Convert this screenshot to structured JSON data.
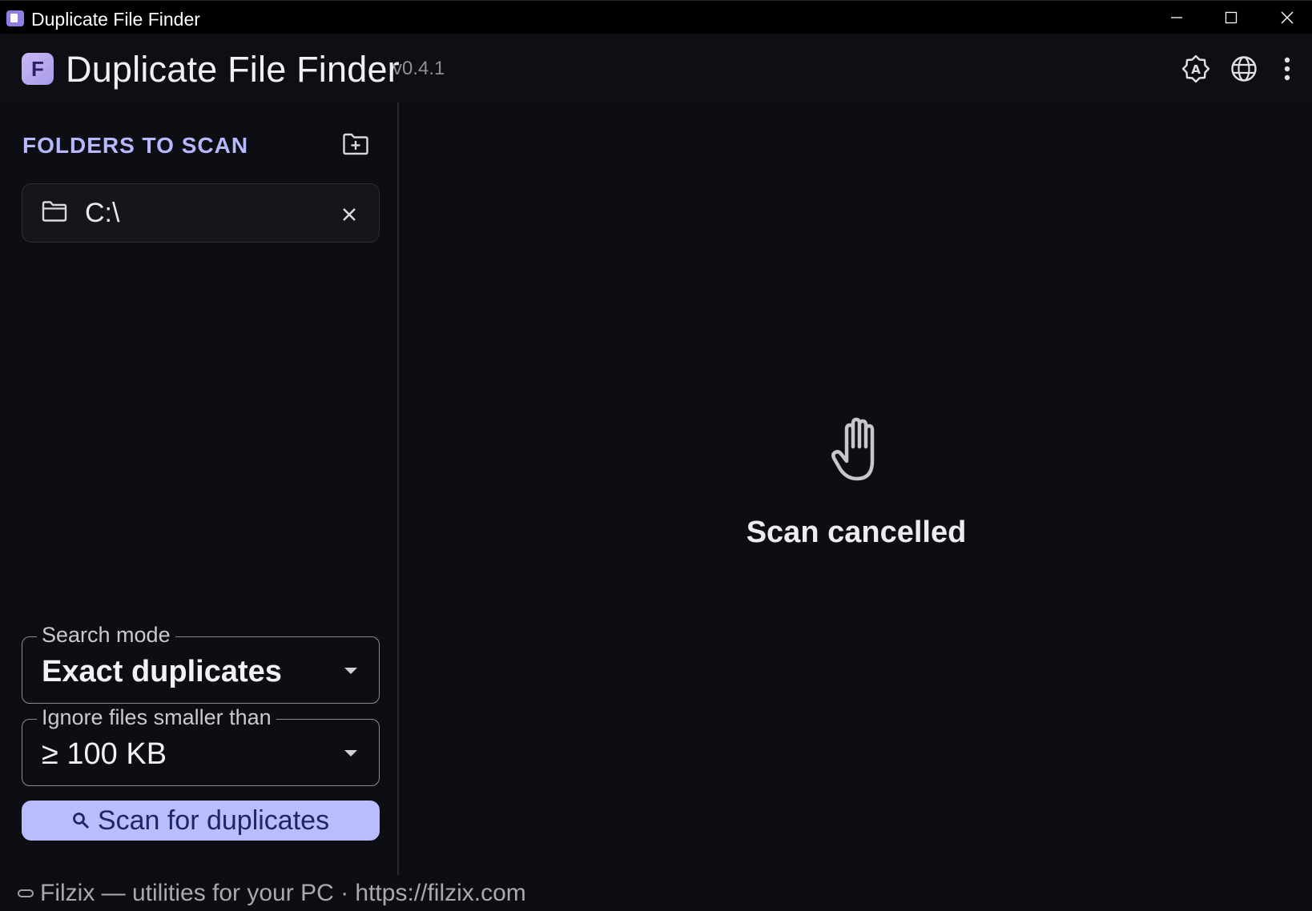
{
  "window": {
    "title": "Duplicate File Finder"
  },
  "header": {
    "logo_letter": "F",
    "app_name": "Duplicate File Finder",
    "version": "v0.4.1"
  },
  "sidebar": {
    "folders_title": "FOLDERS TO SCAN",
    "folders": [
      {
        "path": "C:\\"
      }
    ],
    "search_mode": {
      "label": "Search mode",
      "value": "Exact duplicates"
    },
    "min_size": {
      "label": "Ignore files smaller than",
      "value": "≥ 100 KB"
    },
    "scan_button": "Scan for duplicates"
  },
  "main": {
    "status": "Scan cancelled"
  },
  "footer": {
    "text": "Filzix — utilities for your PC · https://filzix.com"
  },
  "colors": {
    "accent": "#b9bcff",
    "section_title": "#b7b9ff",
    "background": "#0d0e13"
  }
}
